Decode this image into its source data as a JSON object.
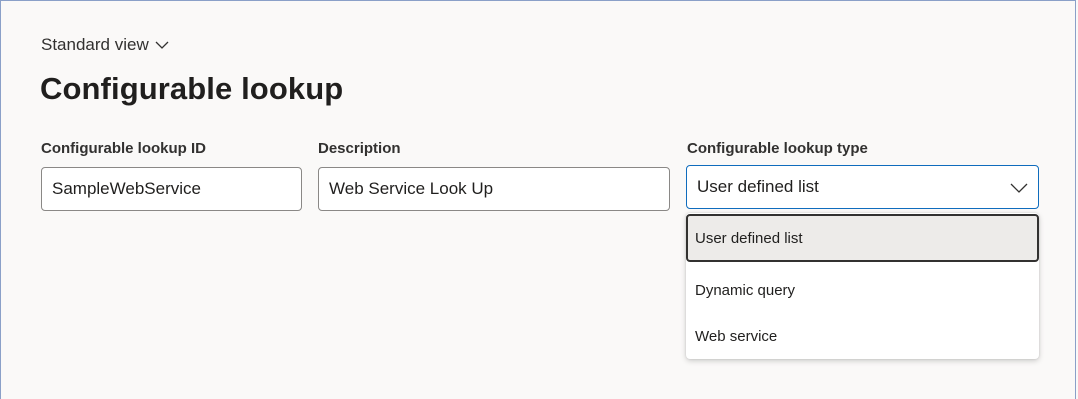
{
  "header": {
    "view_label": "Standard view",
    "title": "Configurable lookup"
  },
  "form": {
    "lookup_id": {
      "label": "Configurable lookup ID",
      "value": "SampleWebService"
    },
    "description": {
      "label": "Description",
      "value": "Web Service Look Up"
    },
    "lookup_type": {
      "label": "Configurable lookup type",
      "value": "User defined list",
      "options": [
        "User defined list",
        "Dynamic query",
        "Web service"
      ]
    }
  },
  "colors": {
    "focus_border": "#0f6cbd",
    "selected_option_bg": "#edebe9"
  },
  "icons": {
    "view_chevron": "chevron-down-icon",
    "combo_chevron": "chevron-down-icon"
  }
}
